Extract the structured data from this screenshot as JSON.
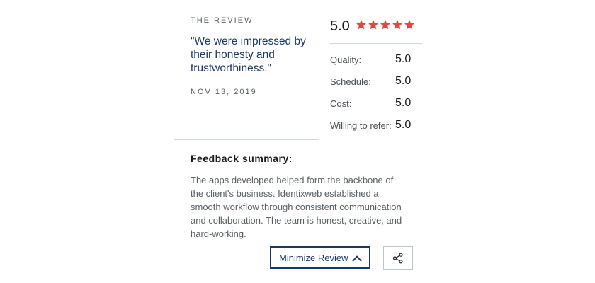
{
  "review": {
    "eyebrow": "THE REVIEW",
    "quote": "\"We were impressed by their honesty and trustworthiness.\"",
    "date": "NOV 13, 2019"
  },
  "rating": {
    "overall": "5.0",
    "stars_filled": 5,
    "stars_total": 5,
    "star_color": "#e4473c",
    "items": [
      {
        "label": "Quality:",
        "value": "5.0"
      },
      {
        "label": "Schedule:",
        "value": "5.0"
      },
      {
        "label": "Cost:",
        "value": "5.0"
      },
      {
        "label": "Willing to refer:",
        "value": "5.0"
      }
    ]
  },
  "feedback": {
    "title": "Feedback summary:",
    "text": "The apps developed helped form the backbone of the client's business. Identixweb established a smooth workflow through consistent communication and collaboration. The team is honest, creative, and hard-working."
  },
  "actions": {
    "minimize_label": "Minimize Review",
    "minimize_icon": "chevron-up-icon",
    "share_icon": "share-icon"
  },
  "colors": {
    "accent": "#1b3a63",
    "divider": "#cfd8dc"
  }
}
